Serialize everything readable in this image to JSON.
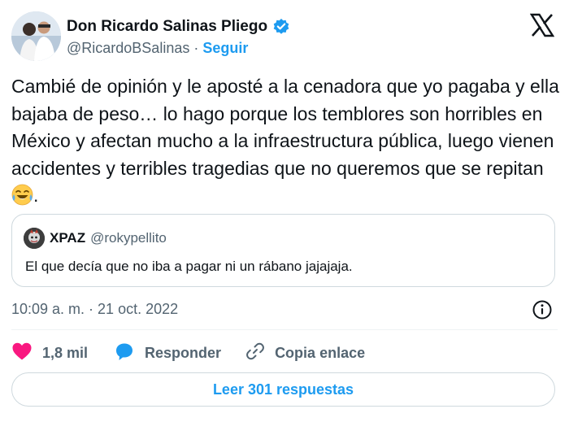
{
  "author": {
    "display_name": "Don Ricardo Salinas Pliego",
    "handle": "@RicardoBSalinas",
    "separator": "·",
    "follow_label": "Seguir",
    "verified_icon": "verified-badge-icon",
    "avatar_icon": "avatar"
  },
  "tweet": {
    "text": "Cambié de opinión y le aposté a la cenadora que yo pagaba y ella bajaba de peso… lo hago porque los temblores son horribles en México y afectan mucho a la infraestructura pública, luego vienen accidentes y terribles tragedias que no queremos que se repitan ",
    "text_end": ".",
    "emoji": "face-with-tears-of-joy-icon"
  },
  "quote": {
    "name": "XPAZ",
    "handle": "@rokypellito",
    "text": "El que decía que no iba a pagar ni un rábano jajajaja."
  },
  "timestamp": "10:09 a. m. · 21 oct. 2022",
  "actions": {
    "like_count": "1,8 mil",
    "reply_label": "Responder",
    "copy_label": "Copia enlace"
  },
  "read_replies_label": "Leer 301 respuestas",
  "colors": {
    "accent": "#1d9bf0",
    "like": "#f91880",
    "text": "#0f1419",
    "muted": "#536471",
    "border": "#cfd9de"
  }
}
